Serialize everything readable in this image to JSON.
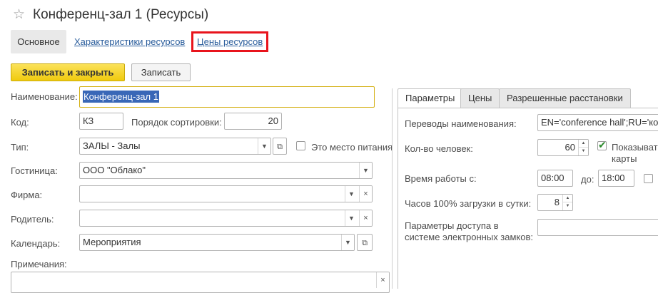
{
  "header": {
    "title": "Конференц-зал 1 (Ресурсы)",
    "star_icon": "star-icon"
  },
  "nav": {
    "links": [
      "Основное",
      "Характеристики ресурсов",
      "Цены ресурсов"
    ],
    "highlight_color": "#e8141c"
  },
  "toolbar": {
    "save_close_label": "Записать и закрыть",
    "save_label": "Записать",
    "accent_color": "#f5d316"
  },
  "form": {
    "name_label": "Наименование:",
    "name_value": "Конференц-зал 1",
    "code_label": "Код:",
    "code_value": "КЗ",
    "sort_label": "Порядок сортировки:",
    "sort_value": "20",
    "type_label": "Тип:",
    "type_value": "ЗАЛЫ - Залы",
    "food_label": "Это место питания",
    "hotel_label": "Гостиница:",
    "hotel_value": "ООО \"Облако\"",
    "firm_label": "Фирма:",
    "firm_value": "",
    "parent_label": "Родитель:",
    "parent_value": "",
    "calendar_label": "Календарь:",
    "calendar_value": "Мероприятия",
    "notes_label": "Примечания:",
    "notes_value": ""
  },
  "right_panel": {
    "tabs": [
      "Параметры",
      "Цены",
      "Разрешенные расстановки"
    ],
    "translations_label": "Переводы наименования:",
    "translations_value": "EN='conference hall';RU='конференц-зал'",
    "people_label": "Кол-во человек:",
    "people_value": "60",
    "show_label_1": "Показывать",
    "show_label_2": "карты",
    "show_checked": true,
    "work_time_label": "Время работы с:",
    "work_from": "08:00",
    "to_label": "до:",
    "work_to": "18:00",
    "hours_label": "Часов 100% загрузки в сутки:",
    "hours_value": "8",
    "access_label_1": "Параметры доступа в",
    "access_label_2": "системе электронных замков:",
    "access_value": ""
  }
}
